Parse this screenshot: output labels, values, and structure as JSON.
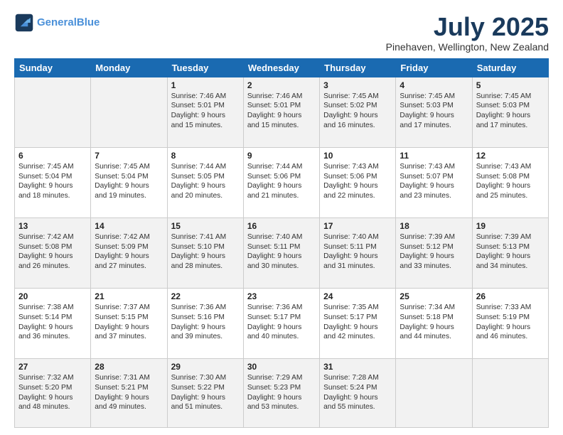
{
  "logo": {
    "line1": "General",
    "line2": "Blue"
  },
  "title": "July 2025",
  "location": "Pinehaven, Wellington, New Zealand",
  "days_of_week": [
    "Sunday",
    "Monday",
    "Tuesday",
    "Wednesday",
    "Thursday",
    "Friday",
    "Saturday"
  ],
  "weeks": [
    [
      {
        "day": "",
        "content": ""
      },
      {
        "day": "",
        "content": ""
      },
      {
        "day": "1",
        "content": "Sunrise: 7:46 AM\nSunset: 5:01 PM\nDaylight: 9 hours\nand 15 minutes."
      },
      {
        "day": "2",
        "content": "Sunrise: 7:46 AM\nSunset: 5:01 PM\nDaylight: 9 hours\nand 15 minutes."
      },
      {
        "day": "3",
        "content": "Sunrise: 7:45 AM\nSunset: 5:02 PM\nDaylight: 9 hours\nand 16 minutes."
      },
      {
        "day": "4",
        "content": "Sunrise: 7:45 AM\nSunset: 5:03 PM\nDaylight: 9 hours\nand 17 minutes."
      },
      {
        "day": "5",
        "content": "Sunrise: 7:45 AM\nSunset: 5:03 PM\nDaylight: 9 hours\nand 17 minutes."
      }
    ],
    [
      {
        "day": "6",
        "content": "Sunrise: 7:45 AM\nSunset: 5:04 PM\nDaylight: 9 hours\nand 18 minutes."
      },
      {
        "day": "7",
        "content": "Sunrise: 7:45 AM\nSunset: 5:04 PM\nDaylight: 9 hours\nand 19 minutes."
      },
      {
        "day": "8",
        "content": "Sunrise: 7:44 AM\nSunset: 5:05 PM\nDaylight: 9 hours\nand 20 minutes."
      },
      {
        "day": "9",
        "content": "Sunrise: 7:44 AM\nSunset: 5:06 PM\nDaylight: 9 hours\nand 21 minutes."
      },
      {
        "day": "10",
        "content": "Sunrise: 7:43 AM\nSunset: 5:06 PM\nDaylight: 9 hours\nand 22 minutes."
      },
      {
        "day": "11",
        "content": "Sunrise: 7:43 AM\nSunset: 5:07 PM\nDaylight: 9 hours\nand 23 minutes."
      },
      {
        "day": "12",
        "content": "Sunrise: 7:43 AM\nSunset: 5:08 PM\nDaylight: 9 hours\nand 25 minutes."
      }
    ],
    [
      {
        "day": "13",
        "content": "Sunrise: 7:42 AM\nSunset: 5:08 PM\nDaylight: 9 hours\nand 26 minutes."
      },
      {
        "day": "14",
        "content": "Sunrise: 7:42 AM\nSunset: 5:09 PM\nDaylight: 9 hours\nand 27 minutes."
      },
      {
        "day": "15",
        "content": "Sunrise: 7:41 AM\nSunset: 5:10 PM\nDaylight: 9 hours\nand 28 minutes."
      },
      {
        "day": "16",
        "content": "Sunrise: 7:40 AM\nSunset: 5:11 PM\nDaylight: 9 hours\nand 30 minutes."
      },
      {
        "day": "17",
        "content": "Sunrise: 7:40 AM\nSunset: 5:11 PM\nDaylight: 9 hours\nand 31 minutes."
      },
      {
        "day": "18",
        "content": "Sunrise: 7:39 AM\nSunset: 5:12 PM\nDaylight: 9 hours\nand 33 minutes."
      },
      {
        "day": "19",
        "content": "Sunrise: 7:39 AM\nSunset: 5:13 PM\nDaylight: 9 hours\nand 34 minutes."
      }
    ],
    [
      {
        "day": "20",
        "content": "Sunrise: 7:38 AM\nSunset: 5:14 PM\nDaylight: 9 hours\nand 36 minutes."
      },
      {
        "day": "21",
        "content": "Sunrise: 7:37 AM\nSunset: 5:15 PM\nDaylight: 9 hours\nand 37 minutes."
      },
      {
        "day": "22",
        "content": "Sunrise: 7:36 AM\nSunset: 5:16 PM\nDaylight: 9 hours\nand 39 minutes."
      },
      {
        "day": "23",
        "content": "Sunrise: 7:36 AM\nSunset: 5:17 PM\nDaylight: 9 hours\nand 40 minutes."
      },
      {
        "day": "24",
        "content": "Sunrise: 7:35 AM\nSunset: 5:17 PM\nDaylight: 9 hours\nand 42 minutes."
      },
      {
        "day": "25",
        "content": "Sunrise: 7:34 AM\nSunset: 5:18 PM\nDaylight: 9 hours\nand 44 minutes."
      },
      {
        "day": "26",
        "content": "Sunrise: 7:33 AM\nSunset: 5:19 PM\nDaylight: 9 hours\nand 46 minutes."
      }
    ],
    [
      {
        "day": "27",
        "content": "Sunrise: 7:32 AM\nSunset: 5:20 PM\nDaylight: 9 hours\nand 48 minutes."
      },
      {
        "day": "28",
        "content": "Sunrise: 7:31 AM\nSunset: 5:21 PM\nDaylight: 9 hours\nand 49 minutes."
      },
      {
        "day": "29",
        "content": "Sunrise: 7:30 AM\nSunset: 5:22 PM\nDaylight: 9 hours\nand 51 minutes."
      },
      {
        "day": "30",
        "content": "Sunrise: 7:29 AM\nSunset: 5:23 PM\nDaylight: 9 hours\nand 53 minutes."
      },
      {
        "day": "31",
        "content": "Sunrise: 7:28 AM\nSunset: 5:24 PM\nDaylight: 9 hours\nand 55 minutes."
      },
      {
        "day": "",
        "content": ""
      },
      {
        "day": "",
        "content": ""
      }
    ]
  ]
}
